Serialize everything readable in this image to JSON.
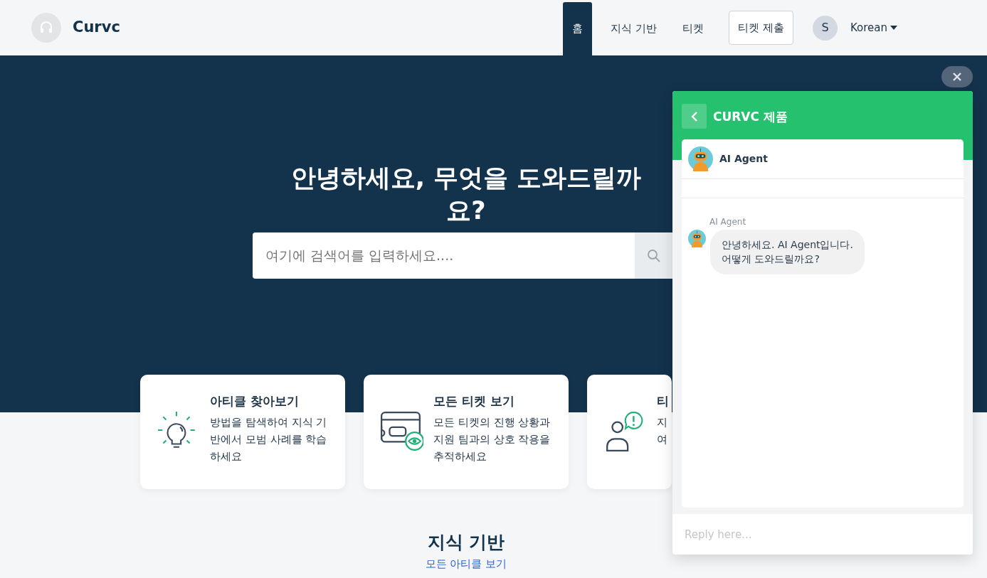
{
  "navbar": {
    "brand": "Curvc",
    "items": [
      {
        "label": "홈",
        "selected": true,
        "kind": "link"
      },
      {
        "label": "지식 기반",
        "selected": false,
        "kind": "link"
      },
      {
        "label": "티켓",
        "selected": false,
        "kind": "link"
      },
      {
        "label": "티켓 제출",
        "kind": "button"
      }
    ],
    "avatar_initial": "S",
    "language": "Korean"
  },
  "hero": {
    "title": "안녕하세요, 무엇을 도와드릴까요?",
    "search": {
      "placeholder": "여기에 검색어를 입력하세요...."
    }
  },
  "cards": [
    {
      "title": "아티클 찾아보기",
      "lines": [
        "방법을 탐색하여 지식 기",
        "반에서 모범 사례를 학습",
        "하세요"
      ]
    },
    {
      "title": "모든 티켓 보기",
      "lines": [
        "모든 티켓의 진행 상황과",
        "지원 팀과의 상호 작용을",
        "추적하세요"
      ]
    },
    {
      "title": "티",
      "lines": [
        "지",
        "여"
      ]
    }
  ],
  "knowledge": {
    "title": "지식 기반",
    "link": "모든 아티클 보기"
  },
  "chat": {
    "title": "CURVC 제품",
    "agent": "AI Agent",
    "messages": [
      {
        "sender": "AI Agent",
        "lines": [
          "안녕하세요. AI Agent입니다.",
          "어떻게 도와드릴까요?"
        ]
      }
    ],
    "reply": {
      "placeholder": "Reply here..."
    }
  }
}
